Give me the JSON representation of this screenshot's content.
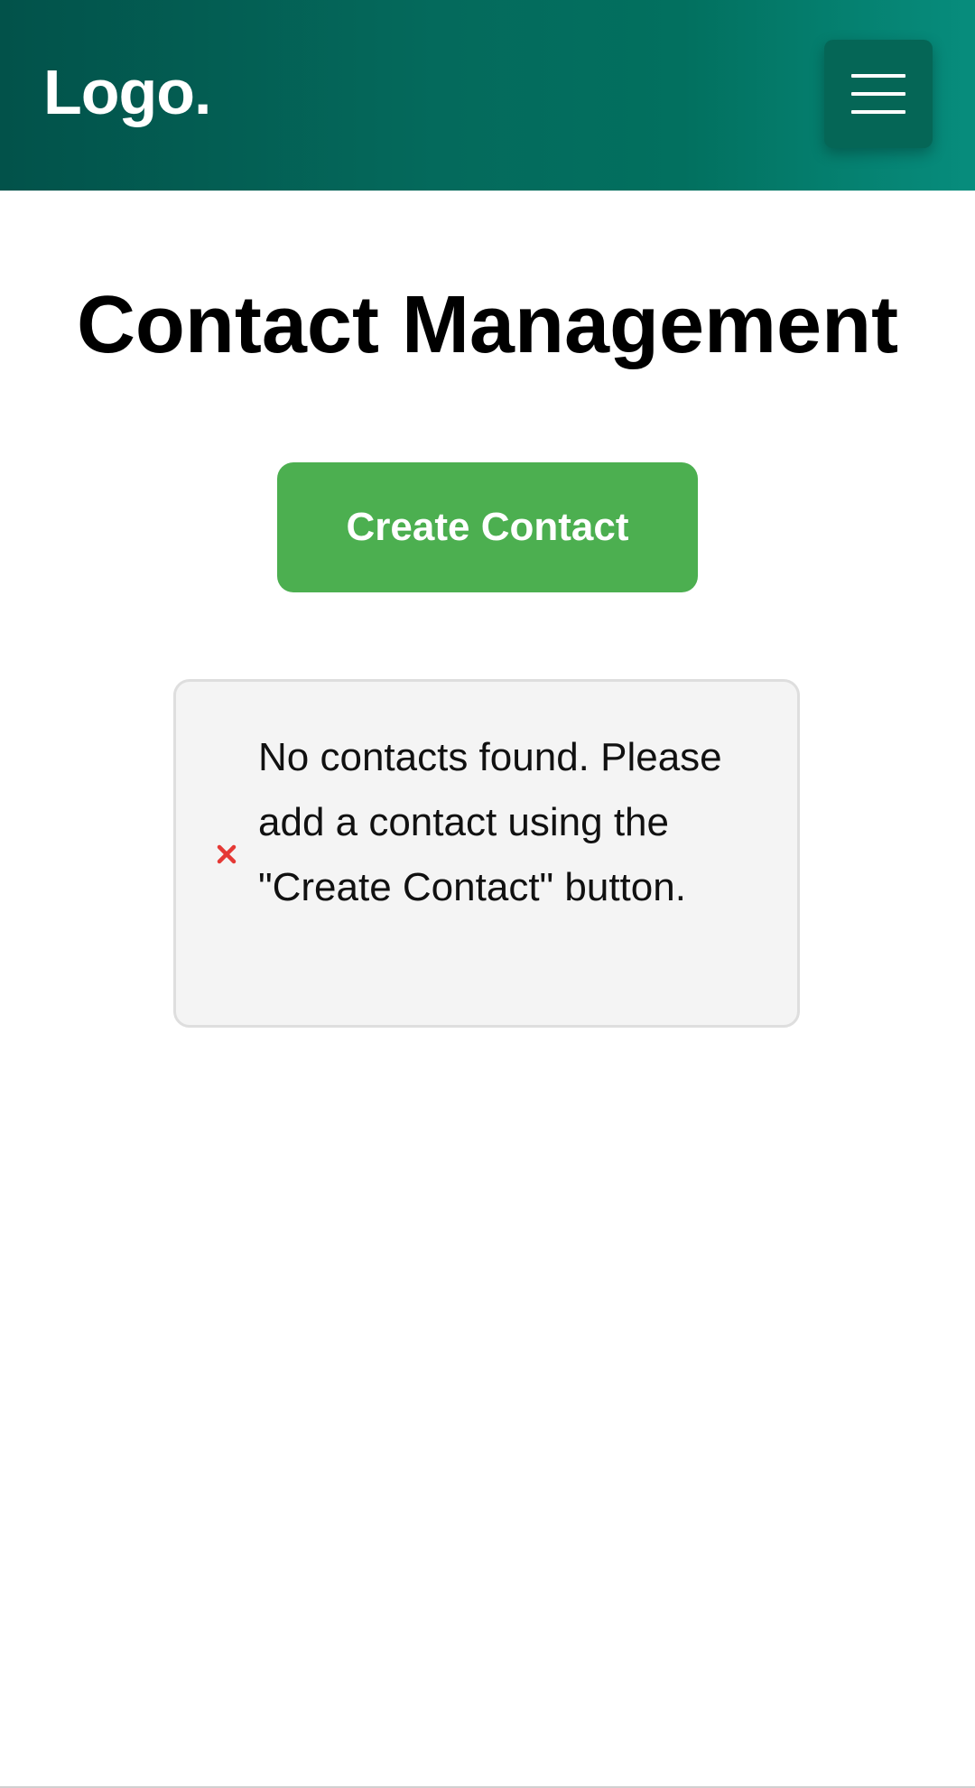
{
  "header": {
    "logo_text": "Logo.",
    "menu_icon": "hamburger-menu-icon",
    "gradient_colors": [
      "#02524a",
      "#078d7d"
    ]
  },
  "main": {
    "title": "Contact Management",
    "create_button_label": "Create Contact",
    "create_button_color": "#4caf50",
    "empty_state": {
      "icon": "close-x-icon",
      "icon_color": "#e53935",
      "message": "No contacts found. Please add a contact using the \"Create Contact\" button."
    }
  }
}
